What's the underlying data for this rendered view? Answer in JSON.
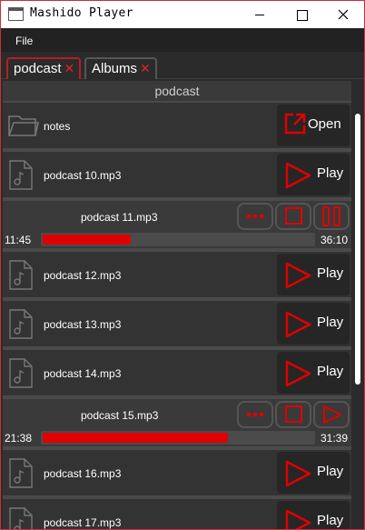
{
  "window": {
    "title": "Mashido Player"
  },
  "menu": {
    "file_label": "File"
  },
  "tabs": [
    {
      "label": "podcast",
      "active": true
    },
    {
      "label": "Albums",
      "active": false
    }
  ],
  "list": {
    "header": "podcast",
    "rows": [
      {
        "type": "folder",
        "name": "notes",
        "action": "Open"
      },
      {
        "type": "file",
        "name": "podcast 10.mp3",
        "action": "Play"
      },
      {
        "type": "playing",
        "name": "podcast 11.mp3",
        "elapsed": "11:45",
        "total": "36:10",
        "progress": 0.325,
        "state": "playing"
      },
      {
        "type": "file",
        "name": "podcast 12.mp3",
        "action": "Play"
      },
      {
        "type": "file",
        "name": "podcast 13.mp3",
        "action": "Play"
      },
      {
        "type": "file",
        "name": "podcast 14.mp3",
        "action": "Play"
      },
      {
        "type": "playing",
        "name": "podcast 15.mp3",
        "elapsed": "21:38",
        "total": "31:39",
        "progress": 0.683,
        "state": "paused"
      },
      {
        "type": "file",
        "name": "podcast 16.mp3",
        "action": "Play"
      },
      {
        "type": "file",
        "name": "podcast 17.mp3",
        "action": "Play"
      }
    ]
  },
  "colors": {
    "accent": "#e00000",
    "background": "#2b2b2b",
    "row": "#333333"
  }
}
